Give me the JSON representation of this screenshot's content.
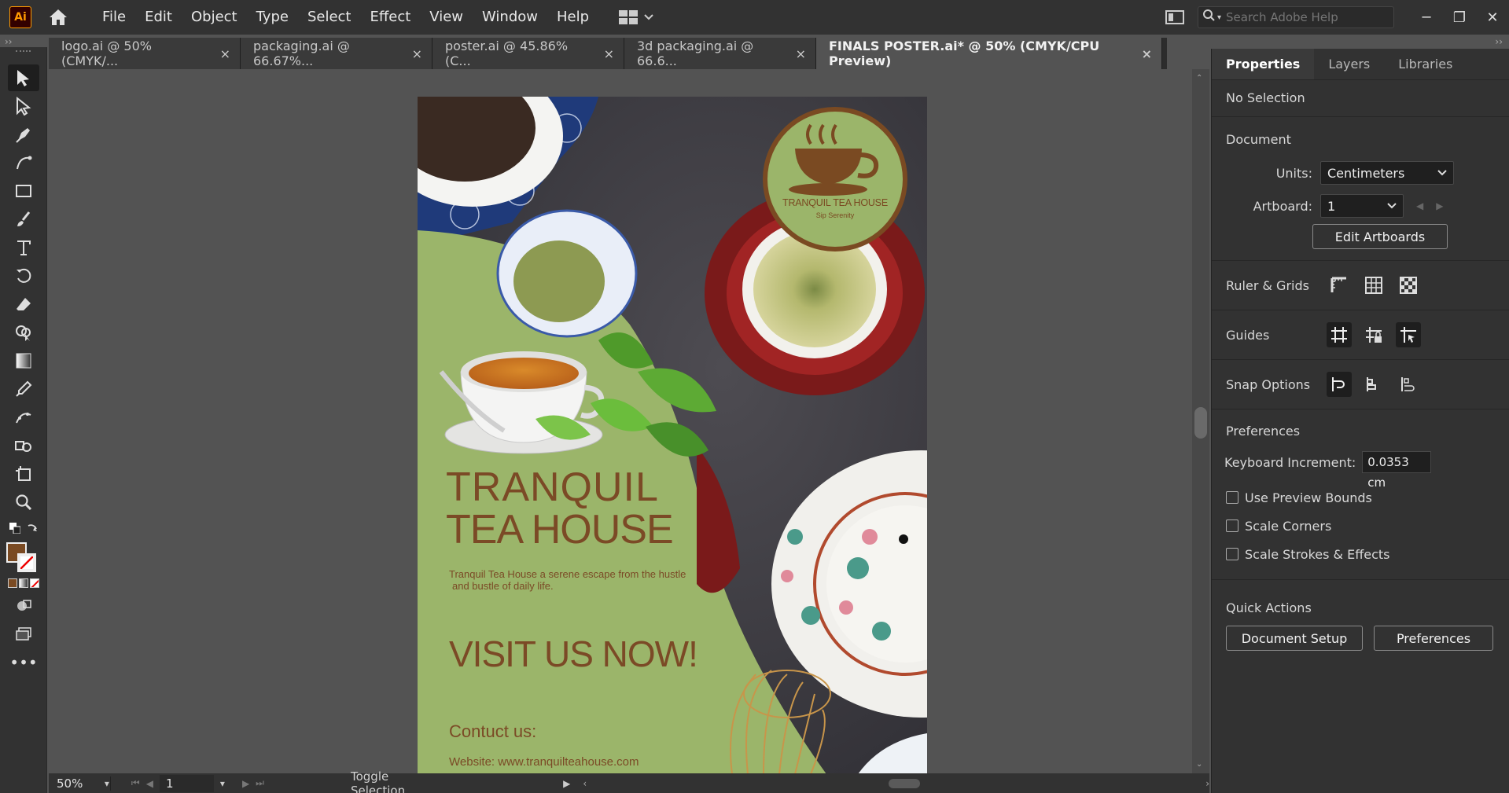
{
  "app": {
    "logo": "Ai"
  },
  "menu": [
    "File",
    "Edit",
    "Object",
    "Type",
    "Select",
    "Effect",
    "View",
    "Window",
    "Help"
  ],
  "search": {
    "placeholder": "Search Adobe Help"
  },
  "tabs": [
    {
      "label": "logo.ai @ 50% (CMYK/...",
      "active": false
    },
    {
      "label": "packaging.ai @ 66.67%...",
      "active": false
    },
    {
      "label": "poster.ai @ 45.86% (C...",
      "active": false
    },
    {
      "label": "3d packaging.ai @ 66.6...",
      "active": false
    },
    {
      "label": "FINALS POSTER.ai* @ 50% (CMYK/CPU Preview)",
      "active": true
    }
  ],
  "tab_close": "×",
  "poster": {
    "title_line1": "TRANQUIL",
    "title_line2": "TEA HOUSE",
    "tagline_line1": "Tranquil Tea House a serene escape from the hustle",
    "tagline_line2": "and bustle of daily life.",
    "cta": "VISIT US NOW!",
    "contact_heading": "Contuct us:",
    "website": "Website: www.tranquilteahouse.com",
    "logo_name": "TRANQUIL TEA HOUSE",
    "logo_sub": "Sip Serenity"
  },
  "status": {
    "zoom": "50%",
    "artboard": "1",
    "text": "Toggle Selection"
  },
  "panel": {
    "tabs": [
      "Properties",
      "Layers",
      "Libraries"
    ],
    "selection": "No Selection",
    "document_label": "Document",
    "units_label": "Units:",
    "units_value": "Centimeters",
    "artboard_label": "Artboard:",
    "artboard_value": "1",
    "edit_artboards": "Edit Artboards",
    "ruler_grids": "Ruler & Grids",
    "guides": "Guides",
    "snap_options": "Snap Options",
    "preferences_label": "Preferences",
    "keyboard_increment_label": "Keyboard Increment:",
    "keyboard_increment_value": "0.0353 cm",
    "checks": [
      "Use Preview Bounds",
      "Scale Corners",
      "Scale Strokes & Effects"
    ],
    "quick_actions": "Quick Actions",
    "document_setup": "Document Setup",
    "preferences_button": "Preferences"
  },
  "colors": {
    "poster_green": "#9bb56a",
    "poster_brown": "#7b4a26",
    "fill_swatch": "#7a4a22"
  }
}
